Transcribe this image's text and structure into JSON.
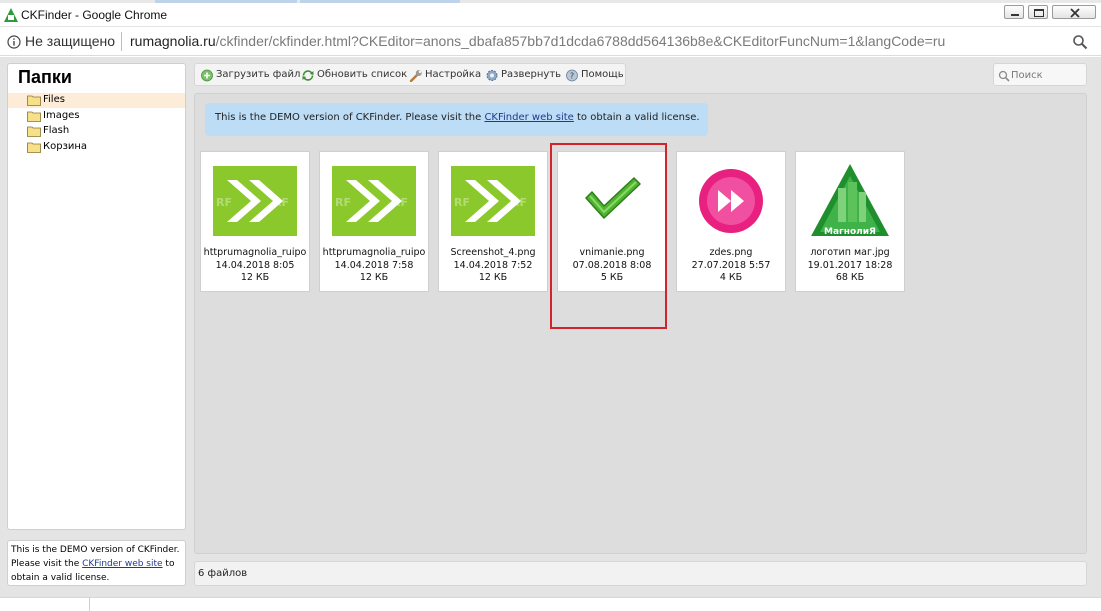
{
  "window": {
    "title": "CKFinder - Google Chrome",
    "controls": [
      "minimize-icon",
      "maximize-icon",
      "close-icon"
    ]
  },
  "address_bar": {
    "security_label": "Не защищено",
    "url_host": "rumagnolia.ru",
    "url_path": "/ckfinder/ckfinder.html?CKEditor=anons_dbafa857bb7d1dcda6788dd564136b8e&CKEditorFuncNum=1&langCode=ru"
  },
  "sidebar": {
    "title": "Папки",
    "folders": [
      {
        "label": "Files",
        "selected": true
      },
      {
        "label": "Images",
        "selected": false
      },
      {
        "label": "Flash",
        "selected": false
      },
      {
        "label": "Корзина",
        "selected": false
      }
    ],
    "demo_notice": {
      "before": "This is the DEMO version of CKFinder. Please visit the ",
      "link": "CKFinder web site",
      "after": " to obtain a valid license."
    }
  },
  "toolbar": {
    "upload": "Загрузить файл",
    "refresh": "Обновить список",
    "settings": "Настройка",
    "maximize": "Развернуть",
    "help": "Помощь"
  },
  "search": {
    "placeholder": "Поиск"
  },
  "notice": {
    "before": "This is the DEMO version of CKFinder. Please visit the ",
    "link": "CKFinder web site",
    "after": " to obtain a valid license."
  },
  "files": [
    {
      "name": "httprumagnolia_ruipo",
      "date": "14.04.2018 8:05",
      "size": "12 КБ",
      "thumb": "green-arrow-image"
    },
    {
      "name": "httprumagnolia_ruipo",
      "date": "14.04.2018 7:58",
      "size": "12 КБ",
      "thumb": "green-arrow-image"
    },
    {
      "name": "Screenshot_4.png",
      "date": "14.04.2018 7:52",
      "size": "12 КБ",
      "thumb": "green-arrow-image"
    },
    {
      "name": "vnimanie.png",
      "date": "07.08.2018 8:08",
      "size": "5 КБ",
      "thumb": "green-checkmark-image"
    },
    {
      "name": "zdes.png",
      "date": "27.07.2018 5:57",
      "size": "4 КБ",
      "thumb": "pink-forward-button-image"
    },
    {
      "name": "логотип маг.jpg",
      "date": "19.01.2017 18:28",
      "size": "68 КБ",
      "thumb": "magnolia-logo-image"
    }
  ],
  "status": {
    "text": "6 файлов"
  },
  "colors": {
    "accent_highlight": "#d2252b",
    "notice_bg": "#bddcf5",
    "selected_folder_bg": "#fcecd8",
    "link": "#1f3b8f"
  }
}
